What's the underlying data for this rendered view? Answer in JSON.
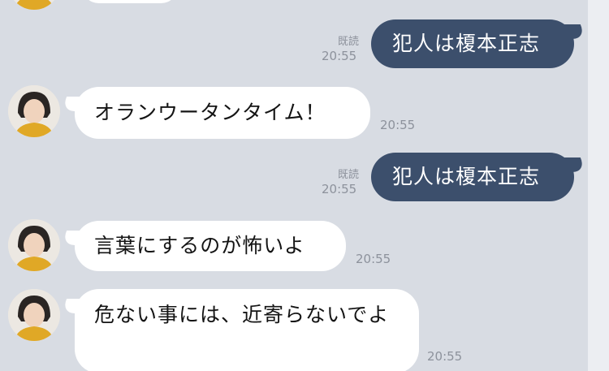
{
  "messages": [
    {
      "dir": "incoming",
      "text": "",
      "time": ""
    },
    {
      "dir": "outgoing",
      "text": "犯人は榎本正志",
      "read": "既読",
      "time": "20:55"
    },
    {
      "dir": "incoming",
      "text": "オランウータンタイム！",
      "time": "20:55"
    },
    {
      "dir": "outgoing",
      "text": "犯人は榎本正志",
      "read": "既読",
      "time": "20:55"
    },
    {
      "dir": "incoming",
      "text": "言葉にするのが怖いよ",
      "time": "20:55"
    },
    {
      "dir": "incoming",
      "text": "危ない事には、近寄らないでよ",
      "time": "20:55"
    }
  ],
  "colors": {
    "background": "#d8dce3",
    "outgoing_bubble": "#3c4f6c",
    "incoming_bubble": "#ffffff",
    "meta_text": "#8d929c"
  },
  "icons": {
    "avatar": "contact-avatar-icon"
  }
}
